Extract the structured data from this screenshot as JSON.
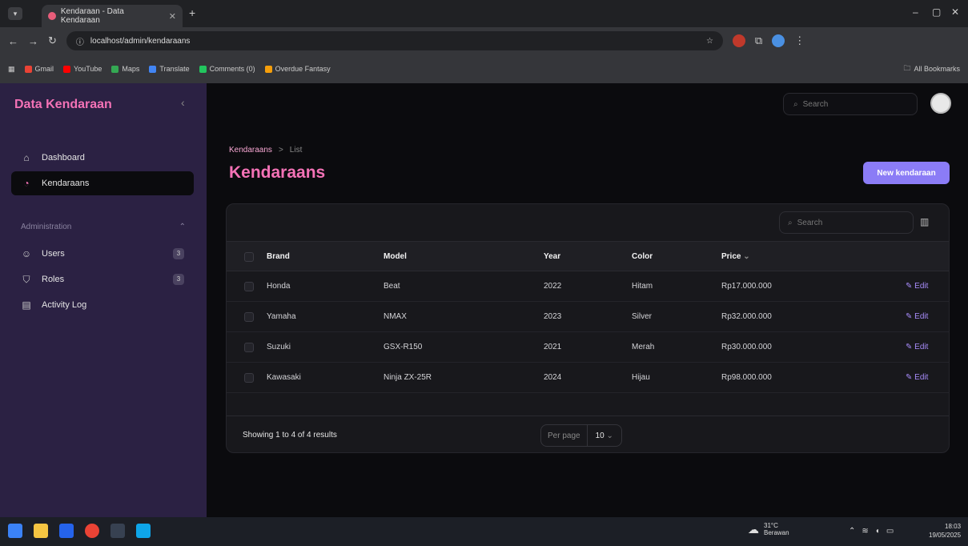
{
  "browser": {
    "tab_title": "Kendaraan - Data Kendaraan",
    "url": "localhost/admin/kendaraans",
    "bookmarks": [
      "Gmail",
      "YouTube",
      "Maps",
      "Translate",
      "Comments (0)",
      "Overdue Fantasy"
    ],
    "all_bookmarks": "All Bookmarks"
  },
  "sidebar": {
    "brand": "Data Kendaraan",
    "items": [
      {
        "label": "Dashboard"
      },
      {
        "label": "Kendaraans"
      }
    ],
    "group_label": "Administration",
    "admin_items": [
      {
        "label": "Users",
        "badge": "3"
      },
      {
        "label": "Roles",
        "badge": "3"
      },
      {
        "label": "Activity Log"
      }
    ]
  },
  "header": {
    "search_placeholder": "Search"
  },
  "page": {
    "breadcrumb": [
      "Kendaraans",
      ">",
      "List"
    ],
    "title": "Kendaraans",
    "new_button": "New kendaraan"
  },
  "table": {
    "search_placeholder": "Search",
    "columns": [
      "Brand",
      "Model",
      "Year",
      "Color",
      "Price"
    ],
    "rows": [
      {
        "brand": "Honda",
        "model": "Beat",
        "year": "2022",
        "color": "Hitam",
        "price": "Rp17.000.000",
        "action": "Edit"
      },
      {
        "brand": "Yamaha",
        "model": "NMAX",
        "year": "2023",
        "color": "Silver",
        "price": "Rp32.000.000",
        "action": "Edit"
      },
      {
        "brand": "Suzuki",
        "model": "GSX-R150",
        "year": "2021",
        "color": "Merah",
        "price": "Rp30.000.000",
        "action": "Edit"
      },
      {
        "brand": "Kawasaki",
        "model": "Ninja ZX-25R",
        "year": "2024",
        "color": "Hijau",
        "price": "Rp98.000.000",
        "action": "Edit"
      }
    ],
    "showing": "Showing 1 to 4 of 4 results",
    "per_page_label": "Per page",
    "per_page_value": "10"
  },
  "taskbar": {
    "weather_temp": "31°C",
    "weather_desc": "Berawan",
    "time": "18:03",
    "date": "19/05/2025"
  },
  "colors": {
    "accent": "#f472b6",
    "button": "#8b7cf6",
    "sidebar_bg": "#2b2143"
  }
}
